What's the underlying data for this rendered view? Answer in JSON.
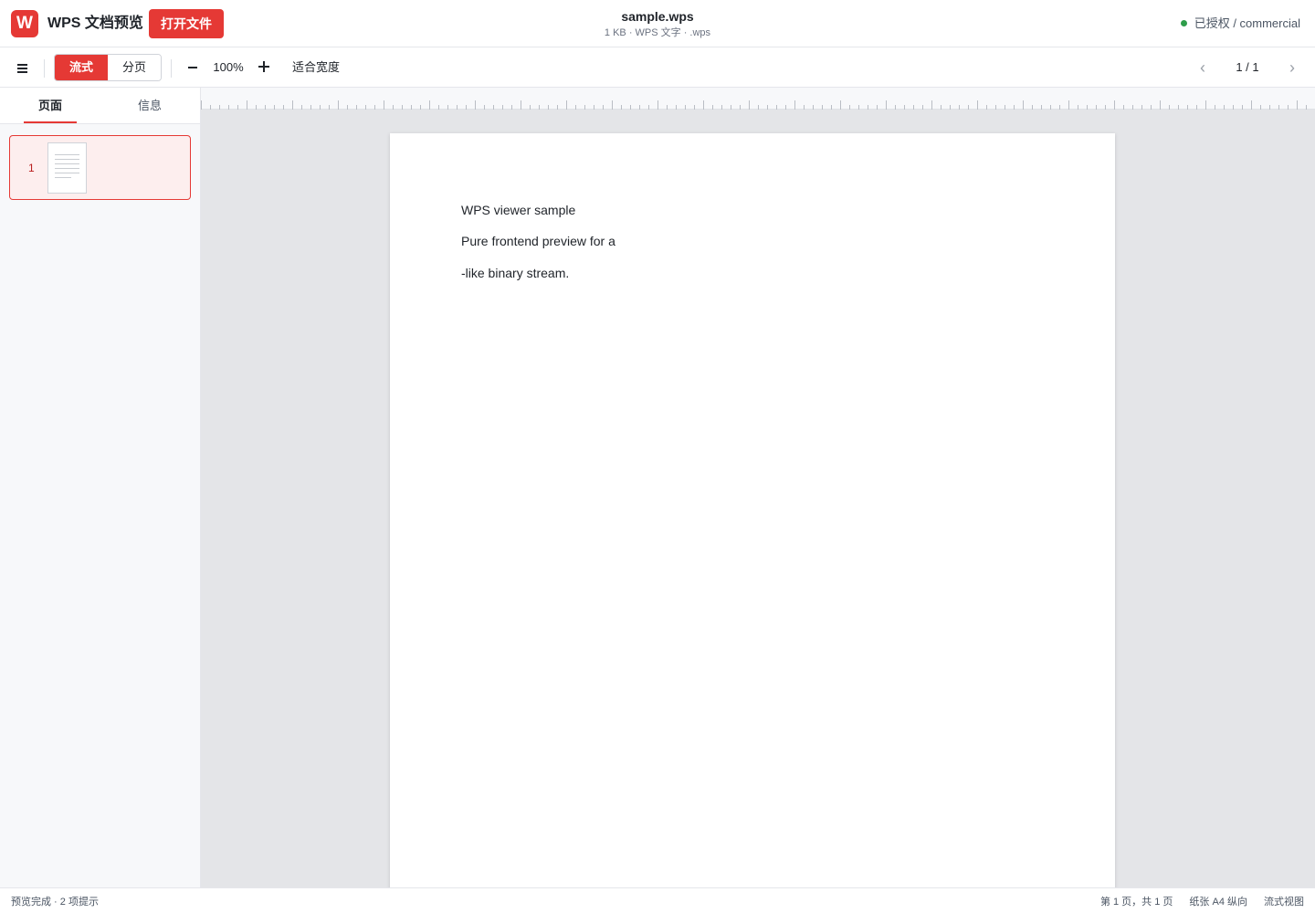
{
  "header": {
    "logo_letter": "W",
    "app_title": "WPS 文档预览",
    "open_button": "打开文件",
    "file_name": "sample.wps",
    "file_meta": "1 KB · WPS 文字 · .wps",
    "license_text": "已授权 / commercial",
    "license_status_color": "#2e9d4a"
  },
  "toolbar": {
    "menu_icon": "hamburger-menu-icon",
    "view_modes": [
      {
        "label": "流式",
        "active": true
      },
      {
        "label": "分页",
        "active": false
      }
    ],
    "zoom_out_icon": "minus-icon",
    "zoom_level": "100%",
    "zoom_in_icon": "plus-icon",
    "fit_width": "适合宽度",
    "prev_icon": "chevron-left-icon",
    "prev_glyph": "‹",
    "page_indicator": "1 / 1",
    "next_icon": "chevron-right-icon",
    "next_glyph": "›"
  },
  "sidebar": {
    "tabs": [
      {
        "label": "页面",
        "active": true
      },
      {
        "label": "信息",
        "active": false
      }
    ],
    "thumbnails": [
      {
        "page_number": "1",
        "selected": true
      }
    ]
  },
  "document": {
    "paragraphs": [
      "WPS viewer sample",
      "Pure frontend preview for a",
      "-like binary stream."
    ]
  },
  "statusbar": {
    "left": "预览完成 · 2 项提示",
    "page_info": "第 1 页，共 1 页",
    "paper_info": "纸张 A4 纵向",
    "view_mode": "流式视图"
  },
  "colors": {
    "accent": "#e53935",
    "selected_thumb_bg": "#fdeeee",
    "canvas_bg": "#e4e5e8"
  }
}
